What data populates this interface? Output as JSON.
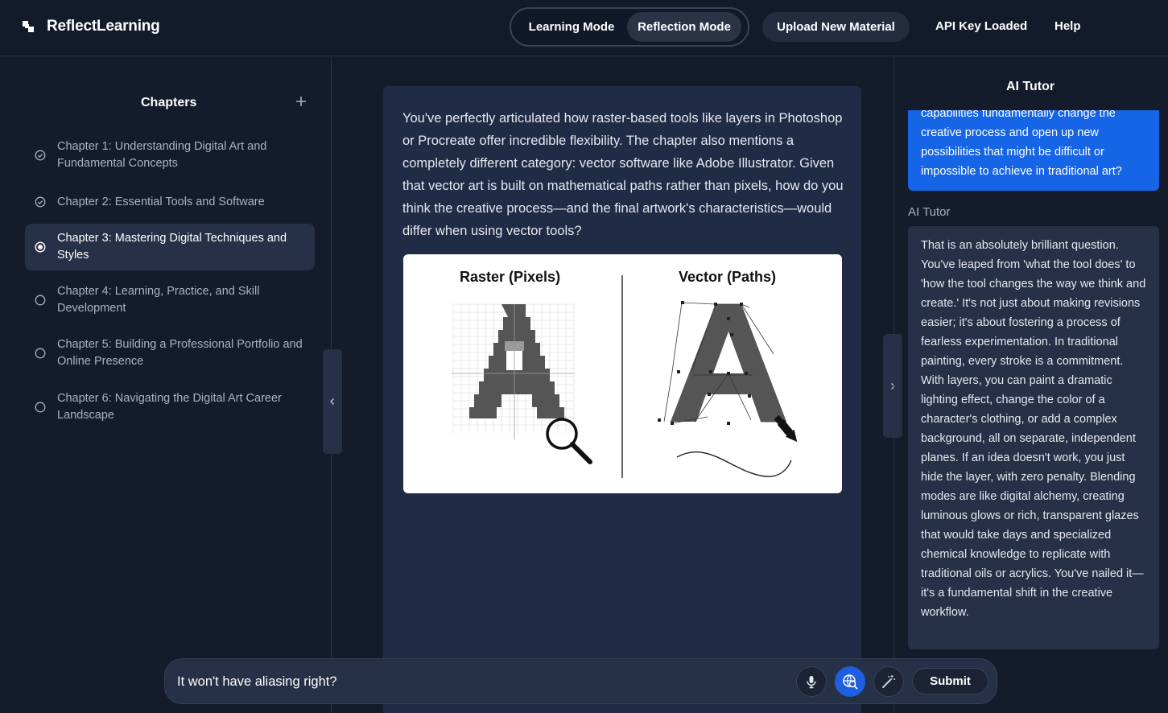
{
  "header": {
    "app_title": "ReflectLearning",
    "modes": [
      {
        "label": "Learning Mode",
        "active": false
      },
      {
        "label": "Reflection Mode",
        "active": true
      }
    ],
    "upload_label": "Upload New Material",
    "api_status": "API Key Loaded",
    "help_label": "Help"
  },
  "sidebar": {
    "title": "Chapters",
    "chapters": [
      {
        "label": "Chapter 1: Understanding Digital Art and Fundamental Concepts",
        "status": "completed"
      },
      {
        "label": "Chapter 2: Essential Tools and Software",
        "status": "completed"
      },
      {
        "label": "Chapter 3: Mastering Digital Techniques and Styles",
        "status": "current"
      },
      {
        "label": "Chapter 4: Learning, Practice, and Skill Development",
        "status": "pending"
      },
      {
        "label": "Chapter 5: Building a Professional Portfolio and Online Presence",
        "status": "pending"
      },
      {
        "label": "Chapter 6: Navigating the Digital Art Career Landscape",
        "status": "pending"
      }
    ]
  },
  "main": {
    "question": "You've perfectly articulated how raster-based tools like layers in Photoshop or Procreate offer incredible flexibility. The chapter also mentions a completely different category: vector software like Adobe Illustrator. Given that vector art is built on mathematical paths rather than pixels, how do you think the creative process—and the final artwork's characteristics—would differ when using vector tools?",
    "figure": {
      "left_label": "Raster (Pixels)",
      "right_label": "Vector (Paths)"
    }
  },
  "tutor": {
    "title": "AI Tutor",
    "user_message": "capabilities fundamentally change the creative process and open up new possibilities that might be difficult or impossible to achieve in traditional art?",
    "ai_label": "AI Tutor",
    "ai_message": "That is an absolutely brilliant question. You've leaped from 'what the tool does' to 'how the tool changes the way we think and create.' It's not just about making revisions easier; it's about fostering a process of fearless experimentation. In traditional painting, every stroke is a commitment. With layers, you can paint a dramatic lighting effect, change the color of a character's clothing, or add a complex background, all on separate, independent planes. If an idea doesn't work, you just hide the layer, with zero penalty. Blending modes are like digital alchemy, creating luminous glows or rich, transparent glazes that would take days and specialized chemical knowledge to replicate with traditional oils or acrylics. You've nailed it—it's a fundamental shift in the creative workflow."
  },
  "input": {
    "value": "It won't have aliasing right?",
    "submit_label": "Submit"
  },
  "colors": {
    "accent": "#1d5fe0",
    "user_bubble": "#1565e6",
    "panel": "#202b45",
    "background": "#141b2b"
  }
}
